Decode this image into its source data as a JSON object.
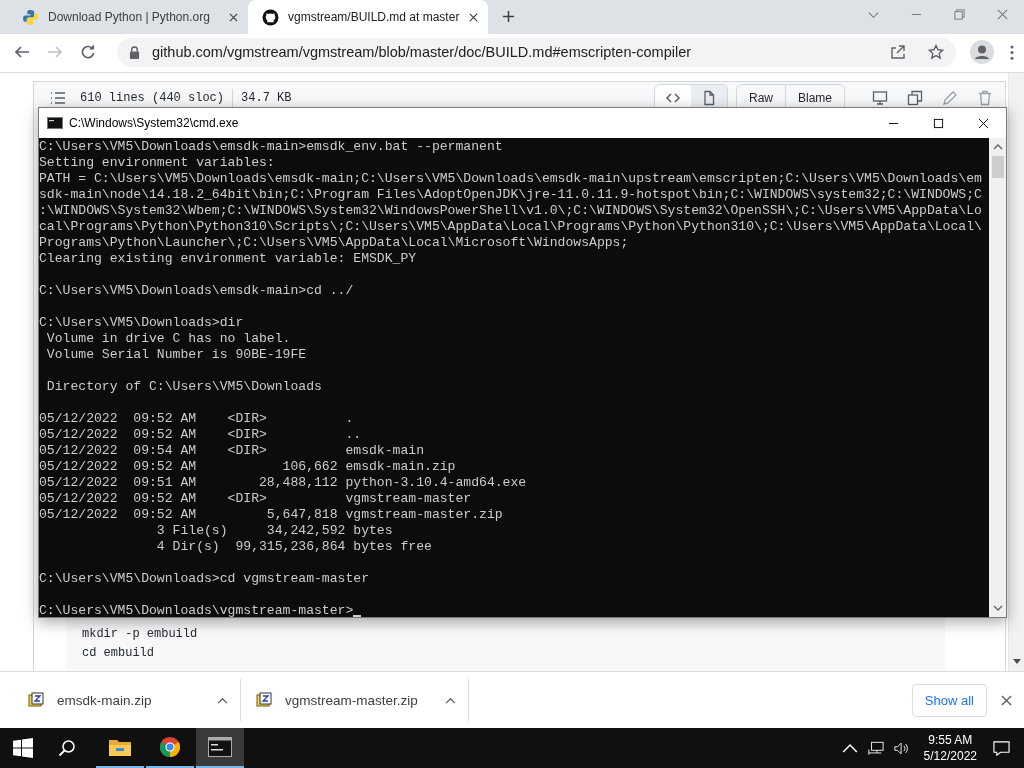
{
  "browser": {
    "tabs": [
      {
        "title": "Download Python | Python.org",
        "selected": false,
        "kind": "python"
      },
      {
        "title": "vgmstream/BUILD.md at master",
        "selected": true,
        "kind": "github"
      }
    ],
    "nav": {
      "back": {
        "disabled": false
      },
      "forward": {
        "disabled": true
      }
    },
    "address_bar": {
      "url": "github.com/vgmstream/vgmstream/blob/master/doc/BUILD.md#emscripten-compiler"
    }
  },
  "file_header": {
    "lines": "610 lines (440 sloc)",
    "size": "34.7 KB",
    "buttons": [
      "Raw",
      "Blame"
    ]
  },
  "code_block": {
    "lines": [
      "mkdir -p embuild",
      "cd embuild"
    ]
  },
  "console_window": {
    "title": "C:\\Windows\\System32\\cmd.exe",
    "blocks": [
      [
        "C:\\Users\\VM5\\Downloads\\emsdk-main>emsdk_env.bat --permanent",
        "Setting environment variables:",
        "PATH = C:\\Users\\VM5\\Downloads\\emsdk-main;C:\\Users\\VM5\\Downloads\\emsdk-main\\upstream\\emscripten;C:\\Users\\VM5\\Downloads\\em",
        "sdk-main\\node\\14.18.2_64bit\\bin;C:\\Program Files\\AdoptOpenJDK\\jre-11.0.11.9-hotspot\\bin;C:\\WINDOWS\\system32;C:\\WINDOWS;C",
        ":\\WINDOWS\\System32\\Wbem;C:\\WINDOWS\\System32\\WindowsPowerShell\\v1.0\\;C:\\WINDOWS\\System32\\OpenSSH\\;C:\\Users\\VM5\\AppData\\Lo",
        "cal\\Programs\\Python\\Python310\\Scripts\\;C:\\Users\\VM5\\AppData\\Local\\Programs\\Python\\Python310\\;C:\\Users\\VM5\\AppData\\Local\\",
        "Programs\\Python\\Launcher\\;C:\\Users\\VM5\\AppData\\Local\\Microsoft\\WindowsApps;",
        "Clearing existing environment variable: EMSDK_PY"
      ],
      [
        "C:\\Users\\VM5\\Downloads\\emsdk-main>cd ../"
      ],
      [
        "C:\\Users\\VM5\\Downloads>dir",
        " Volume in drive C has no label.",
        " Volume Serial Number is 90BE-19FE"
      ],
      [
        " Directory of C:\\Users\\VM5\\Downloads"
      ],
      [
        "05/12/2022  09:52 AM    <DIR>          .",
        "05/12/2022  09:52 AM    <DIR>          ..",
        "05/12/2022  09:54 AM    <DIR>          emsdk-main",
        "05/12/2022  09:52 AM           106,662 emsdk-main.zip",
        "05/12/2022  09:51 AM        28,488,112 python-3.10.4-amd64.exe",
        "05/12/2022  09:52 AM    <DIR>          vgmstream-master",
        "05/12/2022  09:52 AM         5,647,818 vgmstream-master.zip",
        "               3 File(s)     34,242,592 bytes",
        "               4 Dir(s)  99,315,236,864 bytes free"
      ],
      [
        "C:\\Users\\VM5\\Downloads>cd vgmstream-master"
      ],
      [
        "C:\\Users\\VM5\\Downloads\\vgmstream-master>"
      ]
    ]
  },
  "downloads": {
    "items": [
      {
        "name": "emsdk-main.zip"
      },
      {
        "name": "vgmstream-master.zip"
      }
    ],
    "show_all": "Show all"
  },
  "taskbar": {
    "apps": [
      {
        "kind": "explorer",
        "selected": false
      },
      {
        "kind": "chrome",
        "selected": false
      },
      {
        "kind": "console",
        "selected": true
      }
    ],
    "time": "9:55 AM",
    "date": "5/12/2022"
  }
}
